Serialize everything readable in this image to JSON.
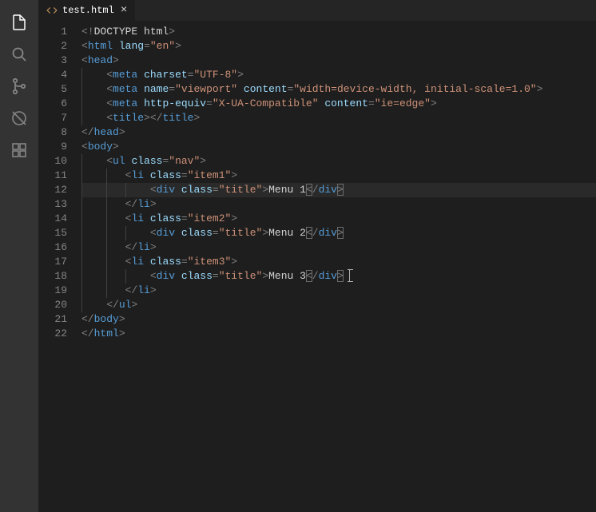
{
  "tab": {
    "filename": "test.html"
  },
  "gutter": {
    "start": 1,
    "end": 22
  },
  "code": {
    "doctype": "DOCTYPE html",
    "html_tag": "html",
    "html_attr": "lang",
    "html_val": "\"en\"",
    "head": "head",
    "meta": "meta",
    "charset_attr": "charset",
    "charset_val": "\"UTF-8\"",
    "name_attr": "name",
    "viewport_val": "\"viewport\"",
    "content_attr": "content",
    "viewport_content": "\"width=device-width, initial-scale=1.0\"",
    "httpequiv_attr": "http-equiv",
    "httpequiv_val": "\"X-UA-Compatible\"",
    "iecontent_val": "\"ie=edge\"",
    "title": "title",
    "body": "body",
    "ul": "ul",
    "class_attr": "class",
    "nav_val": "\"nav\"",
    "li": "li",
    "item1_val": "\"item1\"",
    "item2_val": "\"item2\"",
    "item3_val": "\"item3\"",
    "div": "div",
    "title_val": "\"title\"",
    "menu1": "Menu 1",
    "menu2": "Menu 2",
    "menu3": "Menu 3"
  }
}
